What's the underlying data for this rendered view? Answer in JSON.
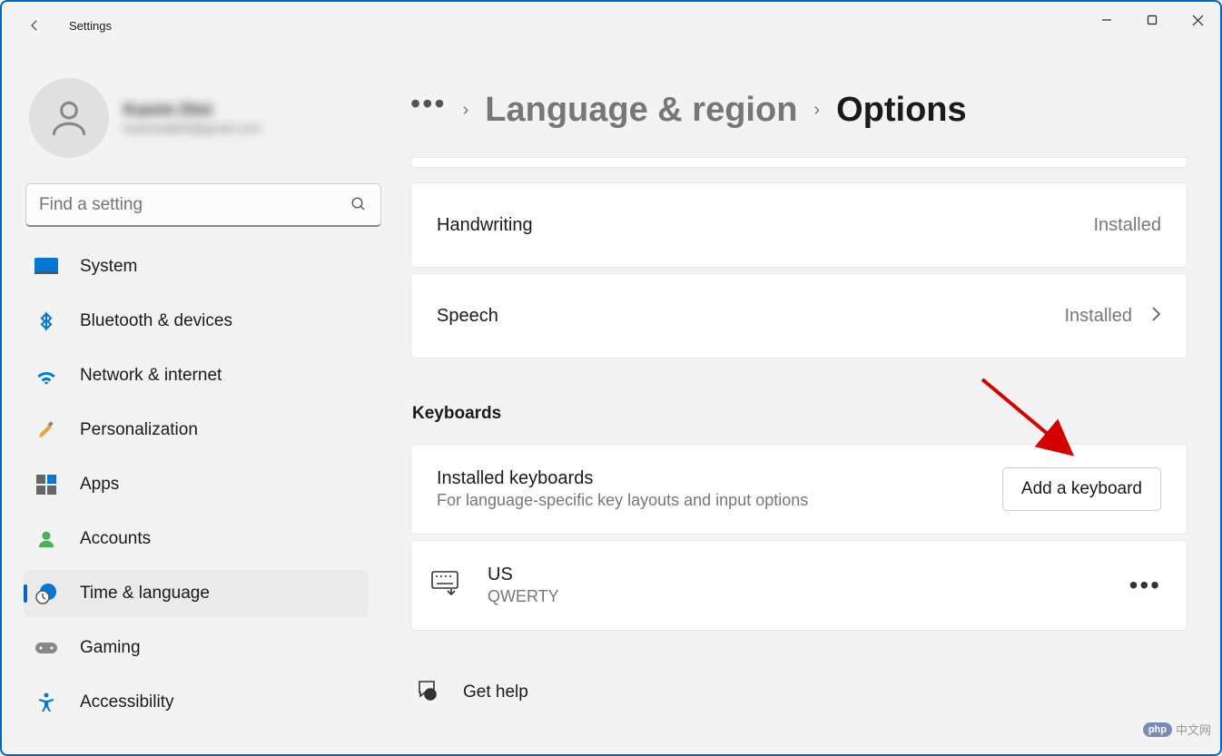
{
  "titlebar": {
    "app_title": "Settings"
  },
  "profile": {
    "name": "Kasim Dini",
    "email": "kasimaddini@gmail.com"
  },
  "search": {
    "placeholder": "Find a setting"
  },
  "nav": [
    {
      "id": "system",
      "label": "System",
      "active": false
    },
    {
      "id": "bluetooth",
      "label": "Bluetooth & devices",
      "active": false
    },
    {
      "id": "network",
      "label": "Network & internet",
      "active": false
    },
    {
      "id": "personalization",
      "label": "Personalization",
      "active": false
    },
    {
      "id": "apps",
      "label": "Apps",
      "active": false
    },
    {
      "id": "accounts",
      "label": "Accounts",
      "active": false
    },
    {
      "id": "time-language",
      "label": "Time & language",
      "active": true
    },
    {
      "id": "gaming",
      "label": "Gaming",
      "active": false
    },
    {
      "id": "accessibility",
      "label": "Accessibility",
      "active": false
    }
  ],
  "breadcrumb": {
    "segments": [
      "Language & region",
      "Options"
    ]
  },
  "features": [
    {
      "title": "Handwriting",
      "status": "Installed",
      "expandable": false
    },
    {
      "title": "Speech",
      "status": "Installed",
      "expandable": true
    }
  ],
  "keyboards_section": {
    "header": "Keyboards",
    "installed_title": "Installed keyboards",
    "installed_sub": "For language-specific key layouts and input options",
    "add_button": "Add a keyboard",
    "items": [
      {
        "name": "US",
        "layout": "QWERTY"
      }
    ]
  },
  "help": {
    "label": "Get help"
  },
  "watermark": {
    "badge": "php",
    "text": "中文网"
  }
}
